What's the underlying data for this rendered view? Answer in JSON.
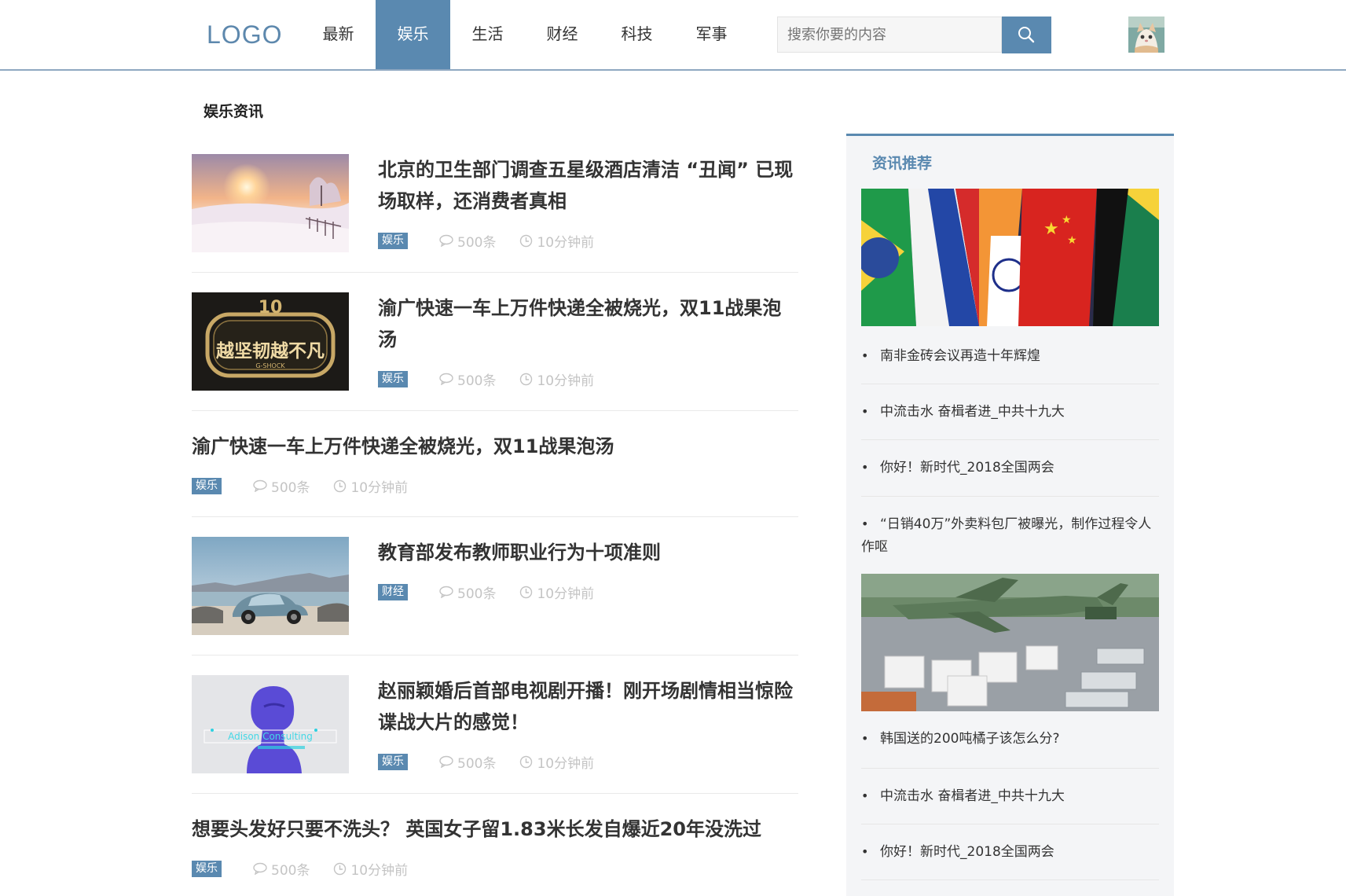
{
  "header": {
    "logo": "LOGO",
    "nav": [
      "最新",
      "娱乐",
      "生活",
      "财经",
      "科技",
      "军事"
    ],
    "active_nav": "娱乐",
    "search_placeholder": "搜索你要的内容"
  },
  "main": {
    "section_title": "娱乐资讯",
    "news": [
      {
        "title": "北京的卫生部门调查五星级酒店清洁 “丑闻” 已现场取样，还消费者真相",
        "tag": "娱乐",
        "comments": "500条",
        "time": "10分钟前"
      },
      {
        "title": "渝广快速一车上万件快递全被烧光，双11战果泡汤",
        "tag": "娱乐",
        "comments": "500条",
        "time": "10分钟前"
      },
      {
        "title": "渝广快速一车上万件快递全被烧光，双11战果泡汤",
        "tag": "娱乐",
        "comments": "500条",
        "time": "10分钟前"
      },
      {
        "title": "教育部发布教师职业行为十项准则",
        "tag": "财经",
        "comments": "500条",
        "time": "10分钟前"
      },
      {
        "title": "赵丽颖婚后首部电视剧开播！刚开场剧情相当惊险谍战大片的感觉！",
        "tag": "娱乐",
        "comments": "500条",
        "time": "10分钟前"
      },
      {
        "title": "想要头发好只要不洗头？ 英国女子留1.83米长发自爆近20年没洗过",
        "tag": "娱乐",
        "comments": "500条",
        "time": "10分钟前"
      }
    ],
    "thumb_text": {
      "gshock": "越坚韧越不凡",
      "gshock_brand": "G-SHOCK",
      "adison": "Adison Consulting"
    }
  },
  "sidebar": {
    "title": "资讯推荐",
    "links_group1": [
      "南非金砖会议再造十年辉煌",
      "中流击水 奋楫者进_中共十九大",
      "你好！新时代_2018全国两会",
      "“日销40万”外卖料包厂被曝光，制作过程令人作呕"
    ],
    "links_group2": [
      "韩国送的200吨橘子该怎么分?",
      "中流击水 奋楫者进_中共十九大",
      "你好！新时代_2018全国两会"
    ]
  },
  "colors": {
    "accent": "#5a89b0",
    "muted": "#c4c4c4",
    "sidebar_bg": "#f4f5f7"
  },
  "icons": [
    "search-icon",
    "comment-icon",
    "clock-icon"
  ]
}
